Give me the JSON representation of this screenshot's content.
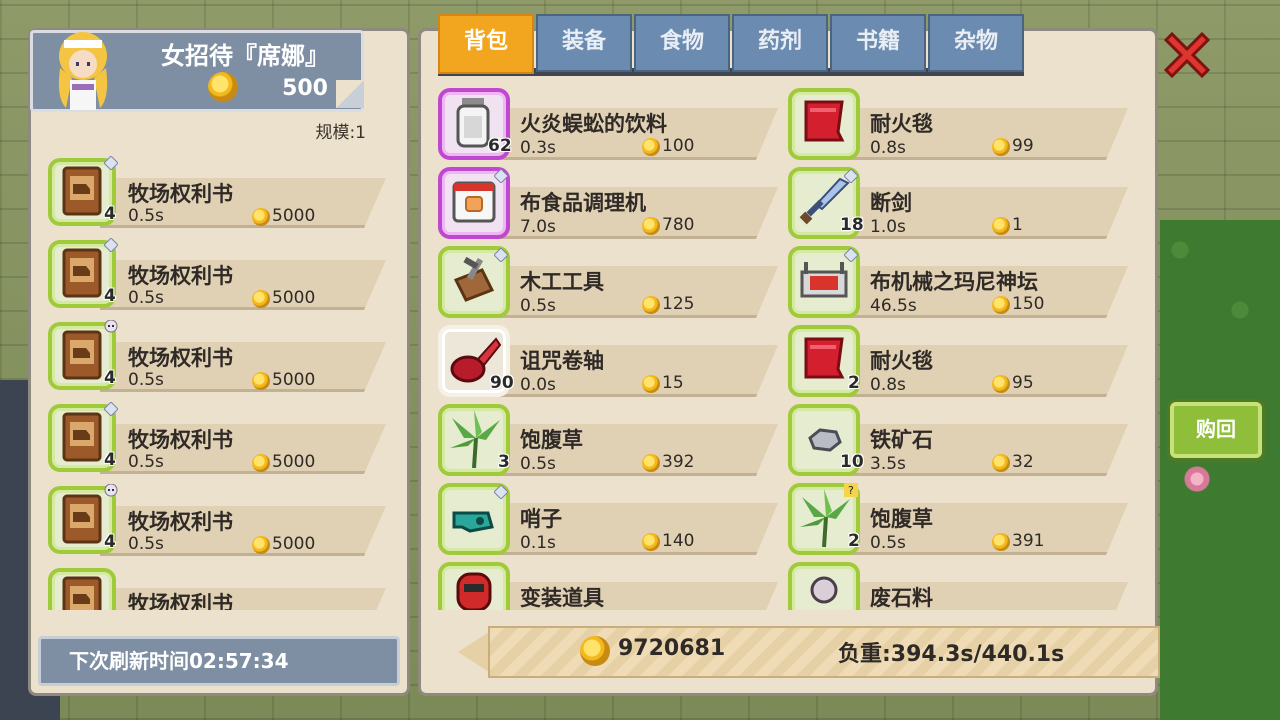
{
  "npc": {
    "name": "女招待『席娜』",
    "gold": "500",
    "scale": "规模:1"
  },
  "tabs": [
    {
      "label": "背包",
      "active": true
    },
    {
      "label": "装备",
      "active": false
    },
    {
      "label": "食物",
      "active": false
    },
    {
      "label": "药剂",
      "active": false
    },
    {
      "label": "书籍",
      "active": false
    },
    {
      "label": "杂物",
      "active": false
    }
  ],
  "shop_items": [
    {
      "name": "牧场权利书",
      "qty": "4",
      "weight": "0.5s",
      "price": "5000",
      "badge": "diamond-icon"
    },
    {
      "name": "牧场权利书",
      "qty": "4",
      "weight": "0.5s",
      "price": "5000",
      "badge": "diamond-icon"
    },
    {
      "name": "牧场权利书",
      "qty": "4",
      "weight": "0.5s",
      "price": "5000",
      "badge": "skull-icon"
    },
    {
      "name": "牧场权利书",
      "qty": "4",
      "weight": "0.5s",
      "price": "5000",
      "badge": "diamond-icon"
    },
    {
      "name": "牧场权利书",
      "qty": "4",
      "weight": "0.5s",
      "price": "5000",
      "badge": "skull-icon"
    },
    {
      "name": "牧场权利书",
      "qty": "",
      "weight": "",
      "price": "",
      "badge": ""
    }
  ],
  "refresh_text": "下次刷新时间02:57:34",
  "bag_items": [
    {
      "name": "火炎蜈蚣的饮料",
      "qty": "62",
      "weight": "0.3s",
      "price": "100",
      "icon": "bottle-icon",
      "frame": "purple"
    },
    {
      "name": "耐火毯",
      "qty": "",
      "weight": "0.8s",
      "price": "99",
      "icon": "red-blanket-icon",
      "frame": "green"
    },
    {
      "name": "布食品调理机",
      "qty": "",
      "weight": "7.0s",
      "price": "780",
      "icon": "cooker-icon",
      "frame": "purple"
    },
    {
      "name": "断剑",
      "qty": "18",
      "weight": "1.0s",
      "price": "1",
      "icon": "broken-sword-icon",
      "frame": "green"
    },
    {
      "name": "木工工具",
      "qty": "",
      "weight": "0.5s",
      "price": "125",
      "icon": "tool-box-icon",
      "frame": "green"
    },
    {
      "name": "布机械之玛尼神坛",
      "qty": "",
      "weight": "46.5s",
      "price": " 150",
      "icon": "altar-icon",
      "frame": "green"
    },
    {
      "name": "诅咒卷轴",
      "qty": "90",
      "weight": "0.0s",
      "price": "15",
      "icon": "scroll-icon",
      "frame": "white"
    },
    {
      "name": "耐火毯",
      "qty": "2",
      "weight": "0.8s",
      "price": "95",
      "icon": "red-blanket-icon",
      "frame": "green"
    },
    {
      "name": "饱腹草",
      "qty": "3",
      "weight": "0.5s",
      "price": "392",
      "icon": "herb-icon",
      "frame": "green"
    },
    {
      "name": "铁矿石",
      "qty": "10",
      "weight": "3.5s",
      "price": "32",
      "icon": "iron-ore-icon",
      "frame": "green"
    },
    {
      "name": "哨子",
      "qty": "",
      "weight": "0.1s",
      "price": "140",
      "icon": "whistle-icon",
      "frame": "green"
    },
    {
      "name": "饱腹草",
      "qty": "2",
      "weight": "0.5s",
      "price": "391",
      "icon": "herb-icon",
      "frame": "green"
    },
    {
      "name": "变装道具",
      "qty": "",
      "weight": "",
      "price": "",
      "icon": "mask-icon",
      "frame": "green"
    },
    {
      "name": "废石料",
      "qty": "",
      "weight": "",
      "price": "",
      "icon": "stone-icon",
      "frame": "green"
    }
  ],
  "footer": {
    "gold": "9720681",
    "load": "负重:394.3s/440.1s"
  },
  "buyback_label": "购回"
}
